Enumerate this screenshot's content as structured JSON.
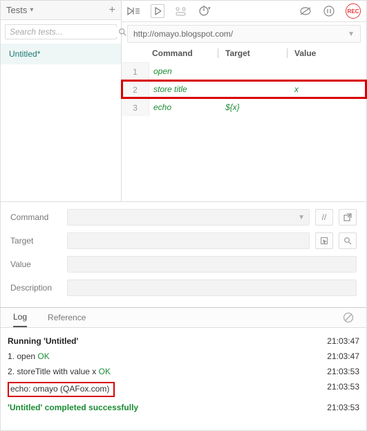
{
  "sidebar": {
    "title": "Tests",
    "search_placeholder": "Search tests...",
    "items": [
      {
        "label": "Untitled*"
      }
    ]
  },
  "toolbar": {
    "rec_label": "REC"
  },
  "url": "http://omayo.blogspot.com/",
  "table": {
    "headers": {
      "command": "Command",
      "target": "Target",
      "value": "Value"
    },
    "rows": [
      {
        "n": "1",
        "command": "open",
        "target": "",
        "value": "",
        "highlight": false
      },
      {
        "n": "2",
        "command": "store title",
        "target": "",
        "value": "x",
        "highlight": true
      },
      {
        "n": "3",
        "command": "echo",
        "target": "${x}",
        "value": "",
        "highlight": false
      }
    ]
  },
  "form": {
    "command_label": "Command",
    "target_label": "Target",
    "value_label": "Value",
    "description_label": "Description",
    "slashes": "//"
  },
  "tabs": {
    "log": "Log",
    "reference": "Reference"
  },
  "log": [
    {
      "text_a": "Running 'Untitled'",
      "text_b": "",
      "ok": false,
      "time": "21:03:47",
      "bold": true
    },
    {
      "text_a": "1.   open ",
      "text_b": "OK",
      "ok": true,
      "time": "21:03:47"
    },
    {
      "text_a": "2.   storeTitle with value x ",
      "text_b": "OK",
      "ok": true,
      "time": "21:03:53"
    },
    {
      "text_a": "echo: omayo (QAFox.com)",
      "text_b": "",
      "ok": false,
      "time": "21:03:53",
      "echohl": true
    },
    {
      "text_a": "'Untitled' completed successfully",
      "text_b": "",
      "ok": false,
      "time": "21:03:53",
      "success": true
    }
  ]
}
